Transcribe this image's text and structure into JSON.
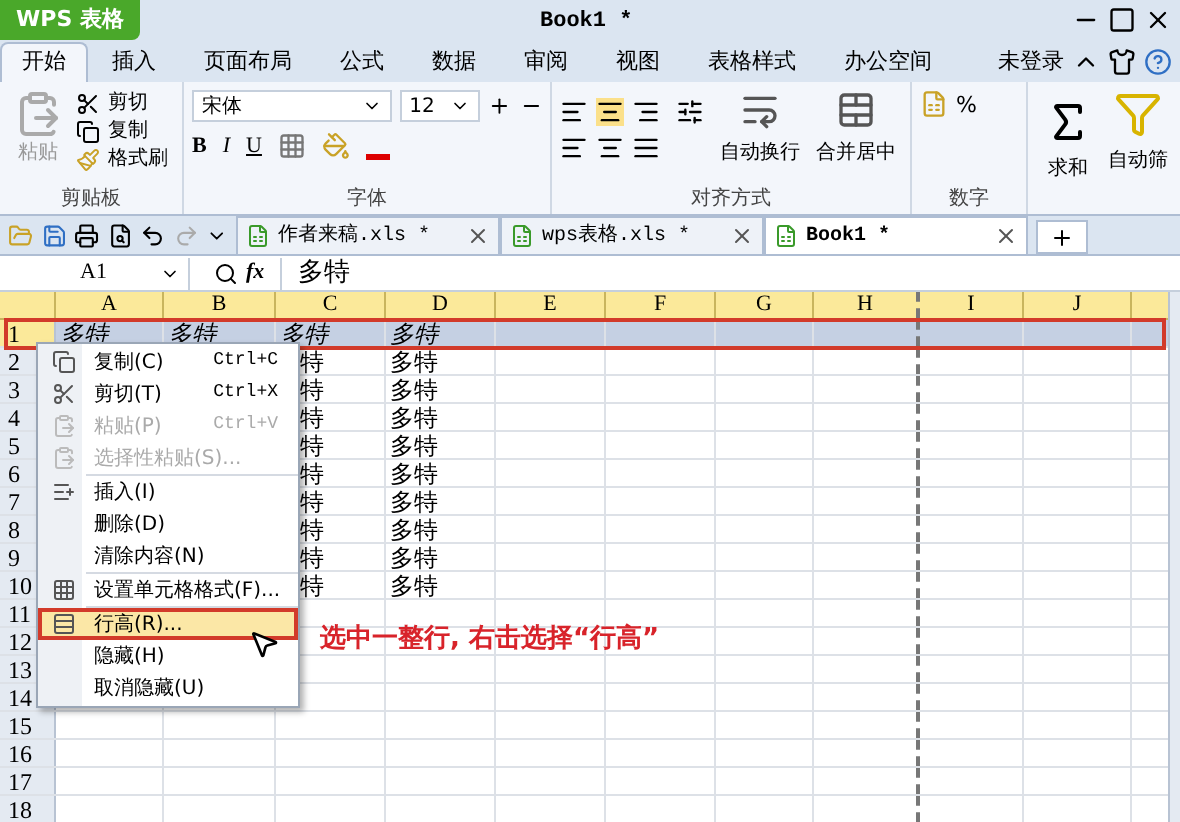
{
  "title_bar": {
    "app_button": "WPS 表格",
    "title": "Book1 *"
  },
  "ribbon_tabs": [
    {
      "label": "开始",
      "selected": true
    },
    {
      "label": "插入",
      "selected": false
    },
    {
      "label": "页面布局",
      "selected": false
    },
    {
      "label": "公式",
      "selected": false
    },
    {
      "label": "数据",
      "selected": false
    },
    {
      "label": "审阅",
      "selected": false
    },
    {
      "label": "视图",
      "selected": false
    },
    {
      "label": "表格样式",
      "selected": false
    },
    {
      "label": "办公空间",
      "selected": false
    }
  ],
  "account": "未登录",
  "ribbon": {
    "clipboard": {
      "paste": "粘贴",
      "cut": "剪切",
      "copy": "复制",
      "format_painter": "格式刷",
      "label": "剪贴板"
    },
    "font": {
      "name": "宋体",
      "size": "12",
      "bold": "B",
      "italic": "I",
      "underline": "U",
      "label": "字体"
    },
    "alignment": {
      "wrap": "自动换行",
      "merge": "合并居中",
      "label": "对齐方式"
    },
    "number": {
      "percent": "%",
      "label": "数字"
    },
    "sum": "求和",
    "filter": "自动筛"
  },
  "doc_tabs": [
    {
      "label": "作者来稿.xls *",
      "selected": false
    },
    {
      "label": "wps表格.xls *",
      "selected": false
    },
    {
      "label": "Book1 *",
      "selected": true
    }
  ],
  "formula_bar": {
    "cell_ref": "A1",
    "fx": "fx",
    "value": "多特"
  },
  "sheet": {
    "columns": [
      "A",
      "B",
      "C",
      "D",
      "E",
      "F",
      "G",
      "H",
      "I",
      "J"
    ],
    "rows": [
      {
        "number": "1",
        "selected": true,
        "cells": {
          "A": "多特",
          "B": "多特",
          "C": "多特",
          "D": "多特"
        }
      },
      {
        "number": "2",
        "selected": false,
        "cells": {
          "C": "特",
          "D": "多特"
        }
      },
      {
        "number": "3",
        "selected": false,
        "cells": {
          "C": "特",
          "D": "多特"
        }
      },
      {
        "number": "4",
        "selected": false,
        "cells": {
          "C": "特",
          "D": "多特"
        }
      },
      {
        "number": "5",
        "selected": false,
        "cells": {
          "C": "特",
          "D": "多特"
        }
      },
      {
        "number": "6",
        "selected": false,
        "cells": {
          "C": "特",
          "D": "多特"
        }
      },
      {
        "number": "7",
        "selected": false,
        "cells": {
          "C": "特",
          "D": "多特"
        }
      },
      {
        "number": "8",
        "selected": false,
        "cells": {
          "C": "特",
          "D": "多特"
        }
      },
      {
        "number": "9",
        "selected": false,
        "cells": {
          "C": "特",
          "D": "多特"
        }
      },
      {
        "number": "10",
        "selected": false,
        "cells": {
          "C": "特",
          "D": "多特"
        }
      },
      {
        "number": "11",
        "selected": false
      },
      {
        "number": "12",
        "selected": false
      },
      {
        "number": "13",
        "selected": false
      },
      {
        "number": "14",
        "selected": false
      },
      {
        "number": "15",
        "selected": false
      },
      {
        "number": "16",
        "selected": false
      },
      {
        "number": "17",
        "selected": false
      },
      {
        "number": "18",
        "selected": false
      }
    ]
  },
  "context_menu": {
    "groups": [
      [
        {
          "kind": "copy",
          "label": "复制(C)",
          "shortcut": "Ctrl+C",
          "disabled": false,
          "selected": false
        },
        {
          "kind": "cut",
          "label": "剪切(T)",
          "shortcut": "Ctrl+X",
          "disabled": false,
          "selected": false
        },
        {
          "kind": "paste",
          "label": "粘贴(P)",
          "shortcut": "Ctrl+V",
          "disabled": true,
          "selected": false
        },
        {
          "kind": "paste",
          "label": "选择性粘贴(S)...",
          "disabled": true,
          "selected": false
        }
      ],
      [
        {
          "kind": "insert",
          "label": "插入(I)",
          "disabled": false,
          "selected": false
        },
        {
          "kind": "plain",
          "label": "删除(D)",
          "disabled": false,
          "selected": false
        },
        {
          "kind": "plain",
          "label": "清除内容(N)",
          "disabled": false,
          "selected": false
        }
      ],
      [
        {
          "kind": "format",
          "label": "设置单元格格式(F)...",
          "disabled": false,
          "selected": false
        }
      ],
      [
        {
          "kind": "row-height",
          "label": "行高(R)...",
          "disabled": false,
          "selected": true
        },
        {
          "kind": "plain",
          "label": "隐藏(H)",
          "disabled": false,
          "selected": false
        },
        {
          "kind": "plain",
          "label": "取消隐藏(U)",
          "disabled": false,
          "selected": false
        }
      ]
    ]
  },
  "annotation": {
    "text": "选中一整行, 右击选择“行高”"
  }
}
